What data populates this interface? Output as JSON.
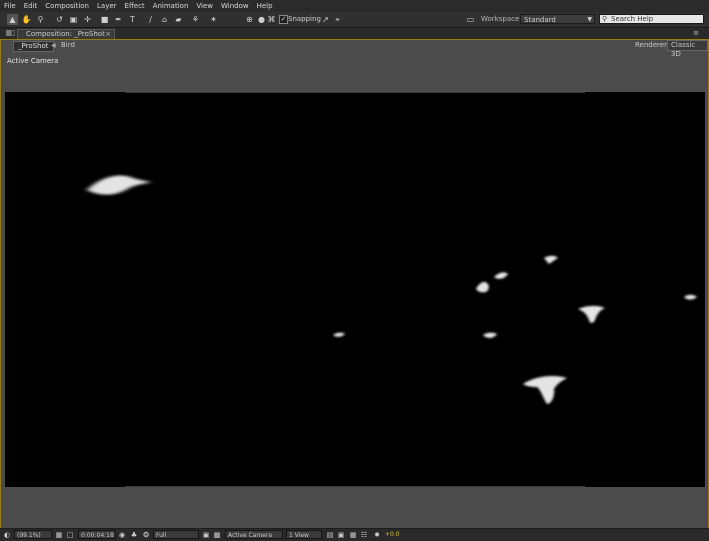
{
  "menu": [
    "File",
    "Edit",
    "Composition",
    "Layer",
    "Effect",
    "Animation",
    "View",
    "Window",
    "Help"
  ],
  "toolbar": {
    "snapping_label": "Snapping",
    "workspace_label": "Workspace:",
    "workspace_value": "Standard",
    "search_placeholder": "Search Help",
    "tools": [
      "selection-tool-icon",
      "hand-tool-icon",
      "zoom-tool-icon",
      "rotate-tool-icon",
      "camera-orbit-icon",
      "pan-behind-icon",
      "rectangle-tool-icon",
      "pen-tool-icon",
      "type-tool-icon",
      "brush-tool-icon",
      "clone-stamp-icon",
      "eraser-tool-icon",
      "roto-brush-icon",
      "puppet-pin-icon"
    ]
  },
  "panel": {
    "tab_title": "Composition: _ProShot",
    "breadcrumb": [
      "_ProShot",
      "Bird"
    ],
    "renderer_label": "Renderer:",
    "renderer_value": "Classic 3D",
    "viewer_label": "Active Camera"
  },
  "bottom_bar": {
    "magnification": "(99.1%)",
    "timecode": "0:00:04:18",
    "resolution": "Full",
    "camera_view": "Active Camera",
    "view_layout": "1 View",
    "exposure": "+0.0"
  },
  "colors": {
    "panel_border": "#9a7b1c",
    "exposure_color": "#d7c23a"
  }
}
